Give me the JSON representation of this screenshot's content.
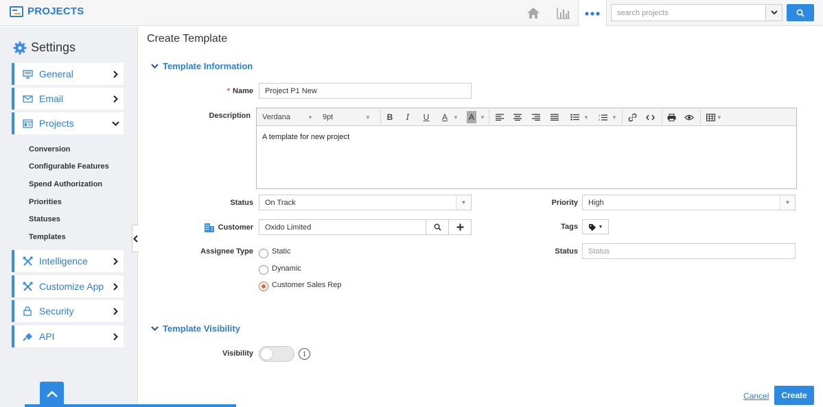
{
  "app": {
    "title": "PROJECTS"
  },
  "search": {
    "placeholder": "search projects"
  },
  "icons": {
    "home": "home-icon",
    "chart": "bar-chart-icon",
    "more": "more-dots-icon",
    "search": "magnifier-icon",
    "settings": "gear-icon"
  },
  "colors": {
    "accent": "#2d8ae0",
    "link": "#2d7ed2",
    "required": "#d9534f",
    "radio_on": "#d2693a"
  },
  "sidebar": {
    "title": "Settings",
    "items": [
      {
        "label": "General",
        "icon": "monitor-icon"
      },
      {
        "label": "Email",
        "icon": "envelope-icon"
      },
      {
        "label": "Projects",
        "icon": "projects-icon"
      },
      {
        "label": "Intelligence",
        "icon": "tools-icon"
      },
      {
        "label": "Customize App",
        "icon": "tools-icon"
      },
      {
        "label": "Security",
        "icon": "lock-icon"
      },
      {
        "label": "API",
        "icon": "plug-icon"
      }
    ],
    "sub_items": [
      "Conversion",
      "Configurable Features",
      "Spend Authorization",
      "Priorities",
      "Statuses",
      "Templates"
    ]
  },
  "main": {
    "page_title": "Create Template",
    "section_info": "Template Information",
    "section_visibility": "Template Visibility",
    "form": {
      "name_label": "Name",
      "name_value": "Project P1 New",
      "description_label": "Description",
      "description_value": "A template for new project",
      "editor": {
        "font": "Verdana",
        "size": "9pt"
      },
      "status_label": "Status",
      "status_value": "On Track",
      "customer_label": "Customer",
      "customer_value": "Oxido Limited",
      "assignee_label": "Assignee Type",
      "assignee_options": [
        "Static",
        "Dynamic",
        "Customer Sales Rep"
      ],
      "assignee_selected": "Customer Sales Rep",
      "priority_label": "Priority",
      "priority_value": "High",
      "tags_label": "Tags",
      "status2_label": "Status",
      "status2_placeholder": "Status",
      "visibility_label": "Visibility",
      "visibility_on": false
    },
    "actions": {
      "cancel": "Cancel",
      "create": "Create"
    }
  }
}
